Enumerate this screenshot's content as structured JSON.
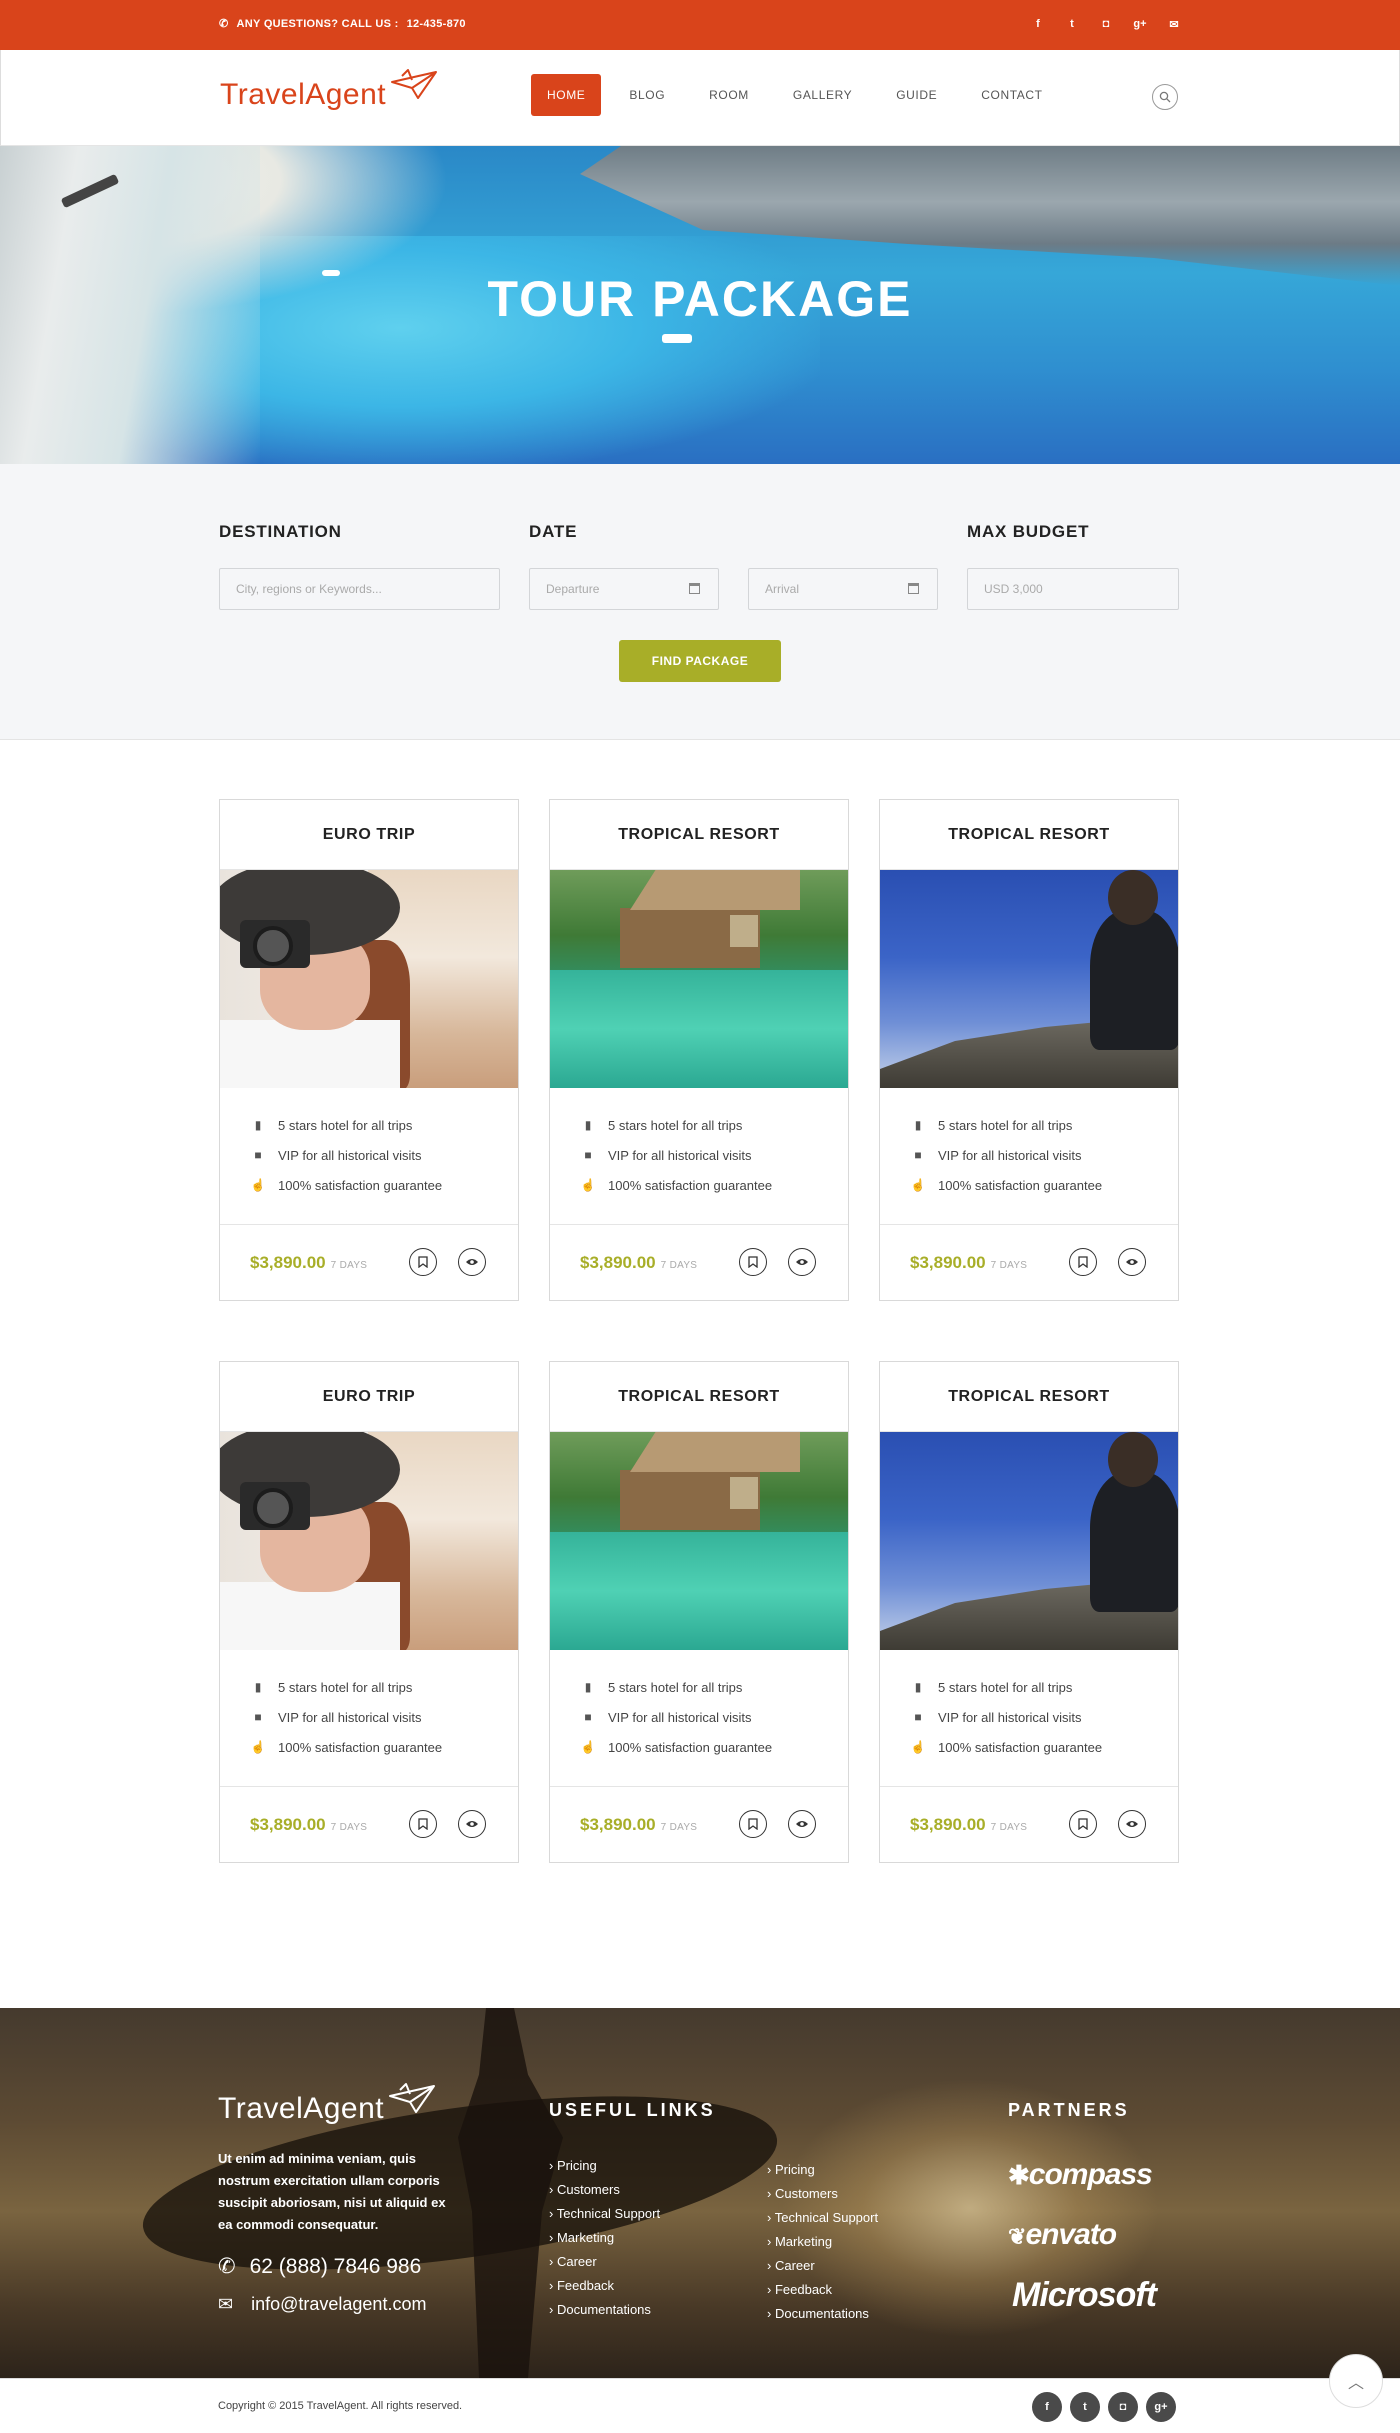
{
  "topbar": {
    "phone_prefix": "ANY QUESTIONS? CALL US :",
    "phone_number": "12-435-870",
    "socials": [
      {
        "icon": "facebook-icon",
        "glyph": "f"
      },
      {
        "icon": "twitter-icon",
        "glyph": "t"
      },
      {
        "icon": "instagram-icon",
        "glyph": "◘"
      },
      {
        "icon": "google-plus-icon",
        "glyph": "g+"
      },
      {
        "icon": "mail-icon",
        "glyph": "✉"
      }
    ]
  },
  "nav": {
    "logo": "TravelAgent",
    "items": [
      "HOME",
      "BLOG",
      "ROOM",
      "GALLERY",
      "GUIDE",
      "CONTACT"
    ],
    "active": "HOME"
  },
  "hero": {
    "title": "TOUR PACKAGE"
  },
  "search": {
    "destination_label": "DESTINATION",
    "date_label": "DATE",
    "budget_label": "MAX BUDGET",
    "destination_placeholder": "City, regions or Keywords...",
    "departure_placeholder": "Departure",
    "arrival_placeholder": "Arrival",
    "budget_placeholder": "USD 3,000",
    "button": "FIND PACKAGE"
  },
  "packages": [
    {
      "title": "EURO TRIP",
      "scene": "euro",
      "price": "$3,890.00",
      "days": "7 DAYS"
    },
    {
      "title": "TROPICAL RESORT",
      "scene": "trop",
      "price": "$3,890.00",
      "days": "7 DAYS"
    },
    {
      "title": "TROPICAL RESORT",
      "scene": "man",
      "price": "$3,890.00",
      "days": "7 DAYS"
    },
    {
      "title": "EURO TRIP",
      "scene": "euro",
      "price": "$3,890.00",
      "days": "7 DAYS"
    },
    {
      "title": "TROPICAL RESORT",
      "scene": "trop",
      "price": "$3,890.00",
      "days": "7 DAYS"
    },
    {
      "title": "TROPICAL RESORT",
      "scene": "man",
      "price": "$3,890.00",
      "days": "7 DAYS"
    }
  ],
  "features": [
    {
      "icon": "building-icon",
      "text": "5 stars hotel for all trips"
    },
    {
      "icon": "video-camera-icon",
      "text": "VIP for all historical visits"
    },
    {
      "icon": "thumbs-up-icon",
      "text": "100% satisfaction guarantee"
    }
  ],
  "footer": {
    "logo": "TravelAgent",
    "about": "Ut enim ad minima veniam, quis nostrum exercitation ullam corporis suscipit aboriosam, nisi ut aliquid ex ea commodi consequatur.",
    "phone": "62 (888) 7846 986",
    "email": "info@travelagent.com",
    "useful_links_title": "USEFUL LINKS",
    "links_col1": [
      "Pricing",
      "Customers",
      "Technical Support",
      "Marketing",
      "Career",
      "Feedback",
      "Documentations"
    ],
    "links_col2": [
      "Pricing",
      "Customers",
      "Technical Support",
      "Marketing",
      "Career",
      "Feedback",
      "Documentations"
    ],
    "partners_title": "PARTNERS",
    "partners": [
      "compass",
      "envato",
      "Microsoft"
    ]
  },
  "bottom": {
    "copyright": "Copyright © 2015 TravelAgent. All rights reserved."
  },
  "colors": {
    "accent": "#d9441b",
    "price": "#a8ae28",
    "button": "#a8ae28"
  }
}
